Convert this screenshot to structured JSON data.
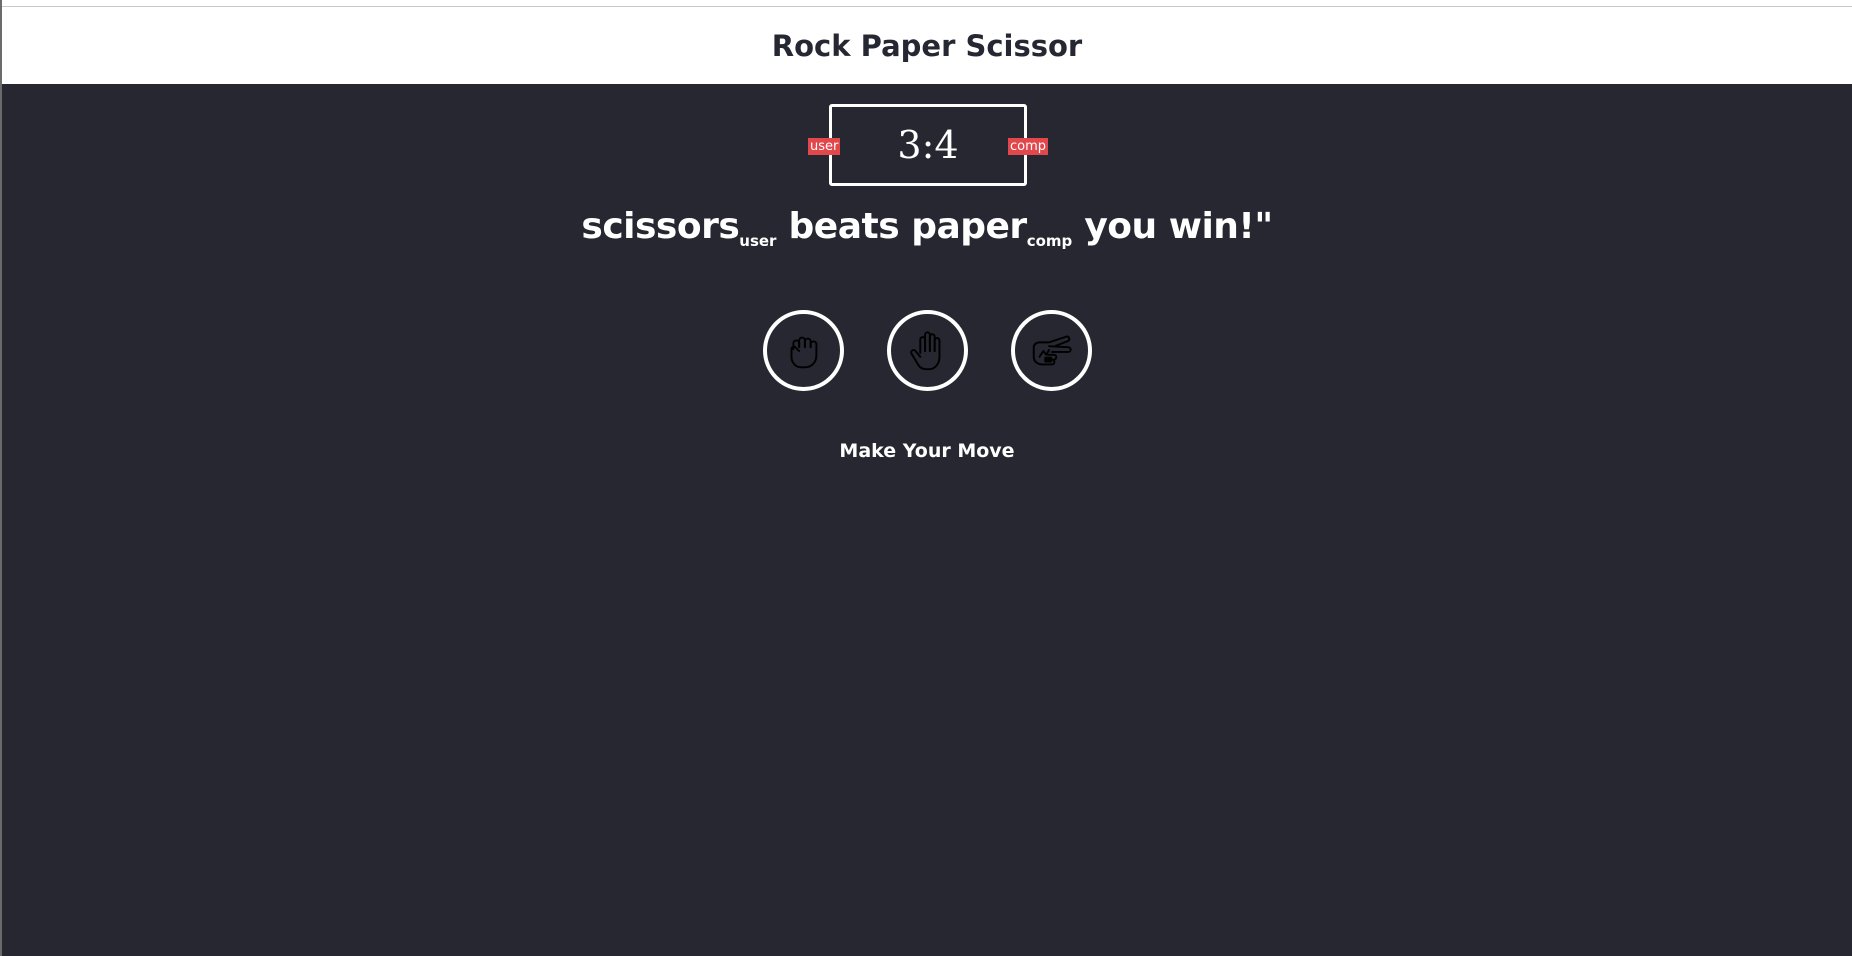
{
  "header": {
    "title": "Rock Paper Scissor"
  },
  "scoreboard": {
    "user_label": "user",
    "comp_label": "comp",
    "user_score": "3",
    "separator": ":",
    "comp_score": "4"
  },
  "result": {
    "user_choice": "scissors",
    "user_tag": "user",
    "verb": "beats",
    "comp_choice": "paper",
    "comp_tag": "comp",
    "outcome": "you win!\""
  },
  "choices": [
    {
      "id": "rock",
      "icon": "rock-hand-icon"
    },
    {
      "id": "paper",
      "icon": "paper-hand-icon"
    },
    {
      "id": "scissors",
      "icon": "scissors-hand-icon"
    }
  ],
  "prompt": "Make Your Move",
  "colors": {
    "header_bg": "#ffffff",
    "header_text": "#252733",
    "game_bg": "#262730",
    "badge": "#e2474b",
    "text": "#ffffff"
  }
}
